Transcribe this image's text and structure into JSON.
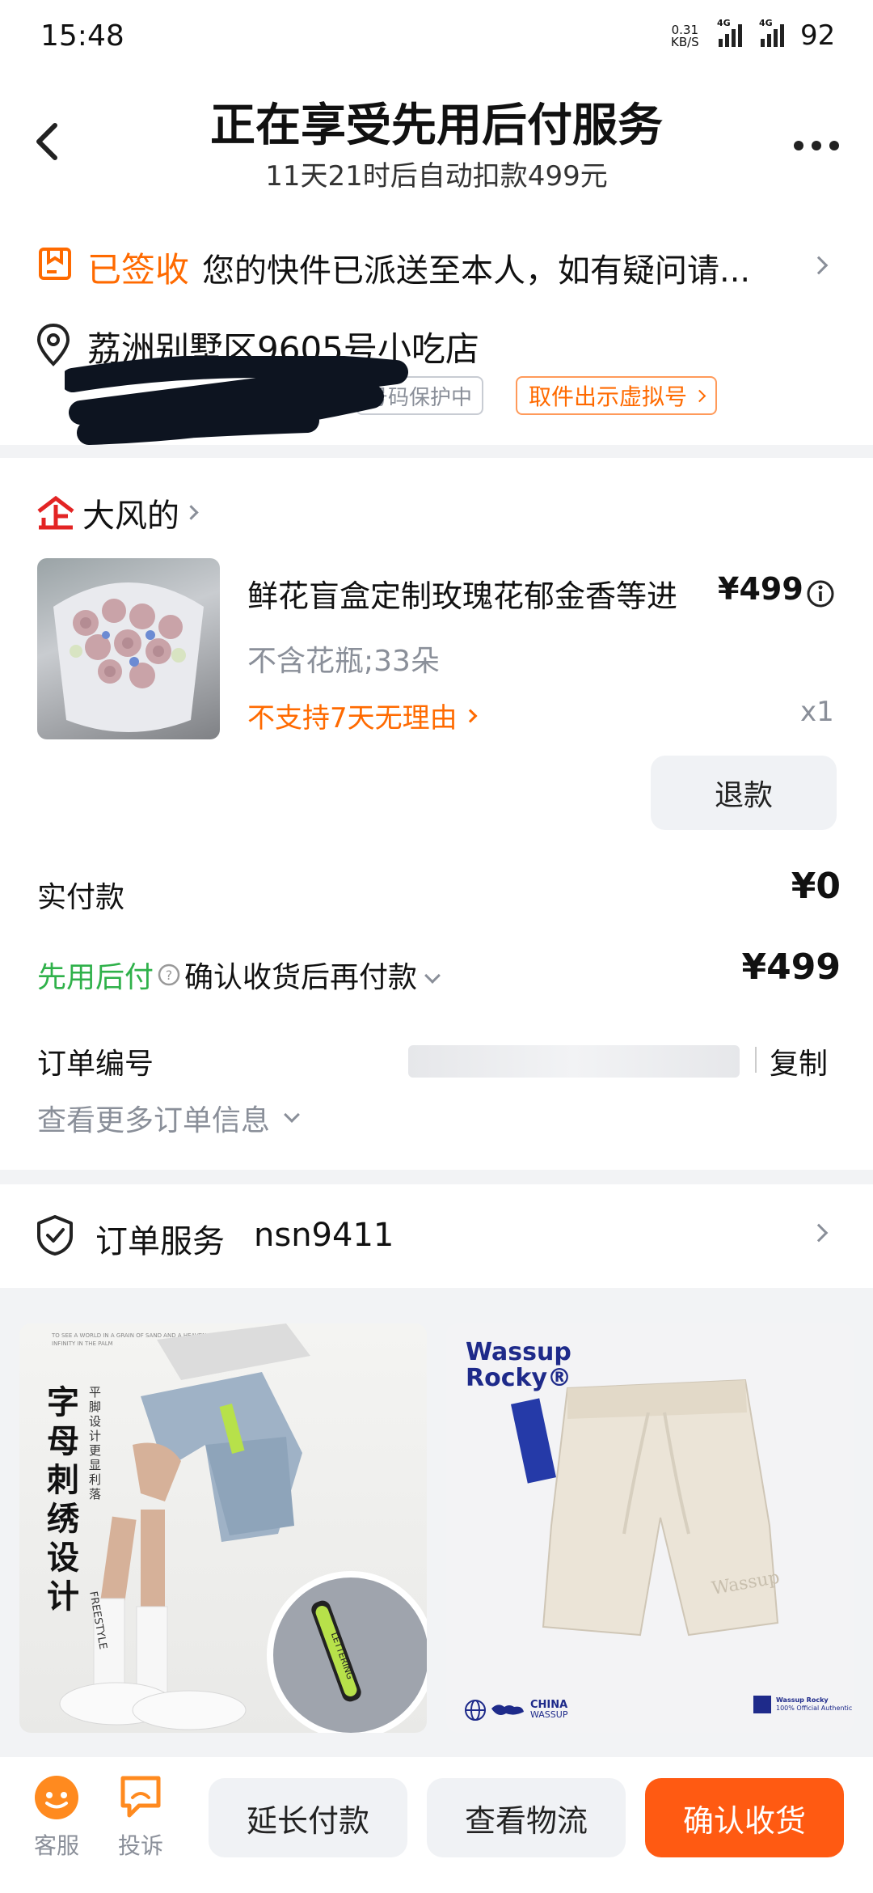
{
  "status": {
    "time": "15:48",
    "net_speed_top": "0.31",
    "net_speed_bottom": "KB/S",
    "battery": "92",
    "net1": "4G",
    "net2": "4G"
  },
  "header": {
    "title": "正在享受先用后付服务",
    "subtitle": "11天21时后自动扣款499元"
  },
  "delivery": {
    "status_label": "已签收",
    "message": "您的快件已派送至本人，如有疑问请...",
    "address": "荔洲别墅区9605号小吃店",
    "privacy_tag": "号码保护中",
    "virtual_tag": "取件出示虚拟号"
  },
  "shop": {
    "name": "大风的"
  },
  "item": {
    "title": "鲜花盲盒定制玫瑰花郁金香等进",
    "price": "¥499",
    "spec": "不含花瓶;33朵",
    "policy": "不支持7天无理由",
    "qty": "x1",
    "refund_button": "退款"
  },
  "payment": {
    "paid_label": "实付款",
    "paid_value": "¥0",
    "bnpl_label": "先用后付",
    "bnpl_desc": "确认收货后再付款",
    "bnpl_value": "¥499"
  },
  "order": {
    "number_label": "订单编号",
    "copy_label": "复制",
    "more_label": "查看更多订单信息"
  },
  "service": {
    "label": "订单服务",
    "code": "nsn9411"
  },
  "ads": {
    "left": {
      "vertical_text": "字母刺绣设计",
      "small_text": "平脚设计更显利落",
      "header_text": "TO SEE A WORLD IN A GRAIN OF SAND AND A HEAVEN IN A WILD FLOWER HOLD INFINITY IN THE PALM",
      "sock_text": "FREESTYLE",
      "badge_text": "LETTERING"
    },
    "right": {
      "brand_line1": "Wassup",
      "brand_line2": "Rocky®",
      "china_label": "CHINA",
      "china_sub": "WASSUP",
      "badge_label": "Wassup Rocky",
      "badge_sub": "100% Official Authentic"
    }
  },
  "bottom": {
    "service_label": "客服",
    "complaint_label": "投诉",
    "extend_button": "延长付款",
    "logistics_button": "查看物流",
    "confirm_button": "确认收货"
  },
  "colors": {
    "accent": "#ff6a00",
    "green": "#2fb14a",
    "gray": "#8a8f99",
    "bg": "#f2f3f5"
  }
}
